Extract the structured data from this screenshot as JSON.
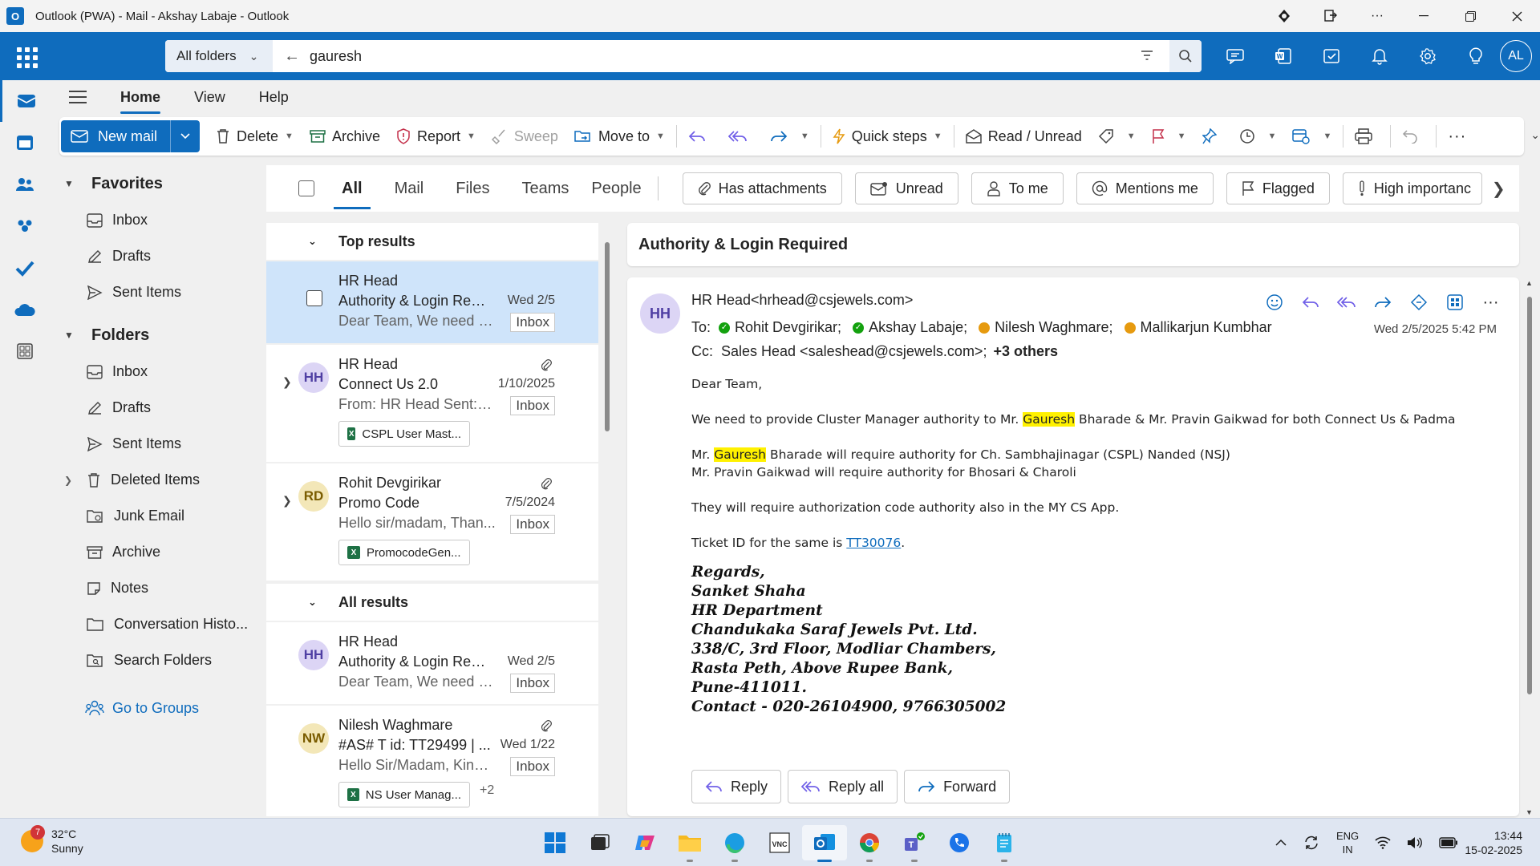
{
  "window": {
    "title": "Outlook (PWA) - Mail - Akshay Labaje - Outlook"
  },
  "header": {
    "search_scope": "All folders",
    "search_query": "gauresh",
    "user_initials": "AL"
  },
  "ribbon": {
    "tabs": [
      "Home",
      "View",
      "Help"
    ],
    "new_mail": "New mail",
    "delete": "Delete",
    "archive": "Archive",
    "report": "Report",
    "sweep": "Sweep",
    "move_to": "Move to",
    "quick_steps": "Quick steps",
    "read_unread": "Read / Unread"
  },
  "folders": {
    "favorites_label": "Favorites",
    "favorites": [
      "Inbox",
      "Drafts",
      "Sent Items"
    ],
    "folders_label": "Folders",
    "items": [
      "Inbox",
      "Drafts",
      "Sent Items",
      "Deleted Items",
      "Junk Email",
      "Archive",
      "Notes",
      "Conversation Histo...",
      "Search Folders"
    ],
    "go_to_groups": "Go to Groups"
  },
  "filters": {
    "tabs": [
      "All",
      "Mail",
      "Files",
      "Teams",
      "People"
    ],
    "pills": [
      "Has attachments",
      "Unread",
      "To me",
      "Mentions me",
      "Flagged",
      "High importanc"
    ]
  },
  "message_list": {
    "top_results_label": "Top results",
    "all_results_label": "All results",
    "top": [
      {
        "sender": "HR Head",
        "subject": "Authority & Login Req...",
        "preview": "Dear Team, We need to...",
        "date": "Wed 2/5",
        "folder": "Inbox"
      },
      {
        "sender": "HR Head",
        "initials": "HH",
        "subject": "Connect Us 2.0",
        "preview": "From: HR Head Sent: 1...",
        "date": "1/10/2025",
        "folder": "Inbox",
        "attachment": "CSPL User Mast..."
      },
      {
        "sender": "Rohit Devgirikar",
        "initials": "RD",
        "subject": "Promo Code",
        "preview": "Hello sir/madam, Than...",
        "date": "7/5/2024",
        "folder": "Inbox",
        "attachment": "PromocodeGen..."
      }
    ],
    "all": [
      {
        "sender": "HR Head",
        "initials": "HH",
        "subject": "Authority & Login Req...",
        "preview": "Dear Team, We need to...",
        "date": "Wed 2/5",
        "folder": "Inbox"
      },
      {
        "sender": "Nilesh Waghmare",
        "initials": "NW",
        "subject": "#AS# T id: TT29499 | ...",
        "preview": "Hello Sir/Madam, Kindl...",
        "date": "Wed 1/22",
        "folder": "Inbox",
        "attachment": "NS User Manag...",
        "more": "+2"
      }
    ]
  },
  "reading": {
    "subject": "Authority & Login Required",
    "initials": "HH",
    "from": "HR Head<hrhead@csjewels.com>",
    "to_label": "To:",
    "to": [
      "Rohit Devgirikar;",
      "Akshay Labaje;",
      "Nilesh Waghmare;",
      "Mallikarjun Kumbhar"
    ],
    "cc_label": "Cc:",
    "cc": "Sales Head <saleshead@csjewels.com>;",
    "cc_more": "+3 others",
    "sent": "Wed 2/5/2025 5:42 PM",
    "body": {
      "greeting": "Dear Team,",
      "p1_a": "We need to provide Cluster Manager authority to Mr.",
      "highlight": "Gauresh",
      "p1_b": "Bharade & Mr. Pravin Gaikwad for both Connect Us & Padma",
      "p2_a": "Mr.",
      "p2_b": "Bharade will require authority for Ch. Sambhajinagar (CSPL) Nanded (NSJ)",
      "p3": "Mr. Pravin Gaikwad will require authority for Bhosari & Charoli",
      "p4": "They will require authorization code authority also in the MY CS App.",
      "p5_a": "Ticket ID for the same is",
      "ticket": "TT30076",
      "p5_b": "."
    },
    "signature": [
      "Regards,",
      "Sanket Shaha",
      "HR Department",
      "Chandukaka Saraf Jewels Pvt. Ltd.",
      "338/C, 3rd Floor, Modliar Chambers,",
      "Rasta Peth, Above Rupee Bank,",
      "Pune-411011.",
      "Contact - 020-26104900, 9766305002"
    ],
    "reply": "Reply",
    "reply_all": "Reply all",
    "forward": "Forward"
  },
  "taskbar": {
    "temp": "32°C",
    "condition": "Sunny",
    "weather_badge": "7",
    "lang1": "ENG",
    "lang2": "IN",
    "time": "13:44",
    "date": "15-02-2025"
  },
  "colors": {
    "accent": "#0f6cbd",
    "selected_row": "#cfe4fa",
    "highlight": "#fff100"
  }
}
